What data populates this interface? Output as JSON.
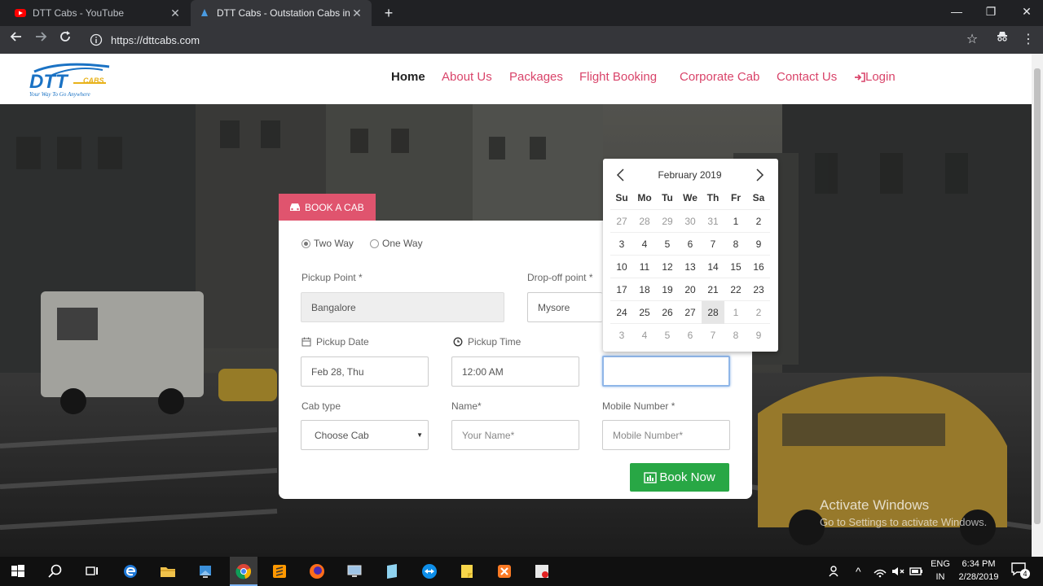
{
  "browser": {
    "tabs": [
      {
        "title": "DTT Cabs - YouTube",
        "active": false,
        "favicon": "youtube-icon"
      },
      {
        "title": "DTT Cabs - Outstation Cabs in Ba",
        "active": true,
        "favicon": "dtt-logo-icon"
      }
    ],
    "url": "https://dttcabs.com"
  },
  "nav": {
    "home": "Home",
    "about": "About Us",
    "packages": "Packages",
    "flight": "Flight Booking",
    "corporate": "Corporate Cab",
    "contact": "Contact Us",
    "login": "Login"
  },
  "booking": {
    "tab_label": "BOOK A CAB",
    "trip": {
      "two_way": "Two Way",
      "one_way": "One Way",
      "selected": "Two Way"
    },
    "pickup_point": {
      "label": "Pickup Point *",
      "value": "Bangalore"
    },
    "dropoff_point": {
      "label": "Drop-off point *",
      "value": "Mysore"
    },
    "pickup_date": {
      "label": "Pickup Date",
      "value": "Feb 28, Thu"
    },
    "pickup_time": {
      "label": "Pickup Time",
      "value": "12:00 AM"
    },
    "cab_type": {
      "label": "Cab type",
      "value": "Choose Cab"
    },
    "name": {
      "label": "Name*",
      "placeholder": "Your Name*"
    },
    "mobile": {
      "label": "Mobile Number *",
      "placeholder": "Mobile Number*"
    },
    "book_button": "Book Now"
  },
  "datepicker": {
    "title": "February 2019",
    "dow": [
      "Su",
      "Mo",
      "Tu",
      "We",
      "Th",
      "Fr",
      "Sa"
    ],
    "weeks": [
      [
        "27",
        "28",
        "29",
        "30",
        "31",
        "1",
        "2"
      ],
      [
        "3",
        "4",
        "5",
        "6",
        "7",
        "8",
        "9"
      ],
      [
        "10",
        "11",
        "12",
        "13",
        "14",
        "15",
        "16"
      ],
      [
        "17",
        "18",
        "19",
        "20",
        "21",
        "22",
        "23"
      ],
      [
        "24",
        "25",
        "26",
        "27",
        "28",
        "1",
        "2"
      ],
      [
        "3",
        "4",
        "5",
        "6",
        "7",
        "8",
        "9"
      ]
    ],
    "selected": "28"
  },
  "watermark": {
    "title": "Activate Windows",
    "subtitle": "Go to Settings to activate Windows."
  },
  "taskbar": {
    "lang": "ENG",
    "region": "IN",
    "time": "6:34 PM",
    "date": "2/28/2019",
    "notifications": "4"
  },
  "colors": {
    "accent": "#e0546e",
    "nav_link": "#d9446a",
    "book_button": "#28a745"
  }
}
